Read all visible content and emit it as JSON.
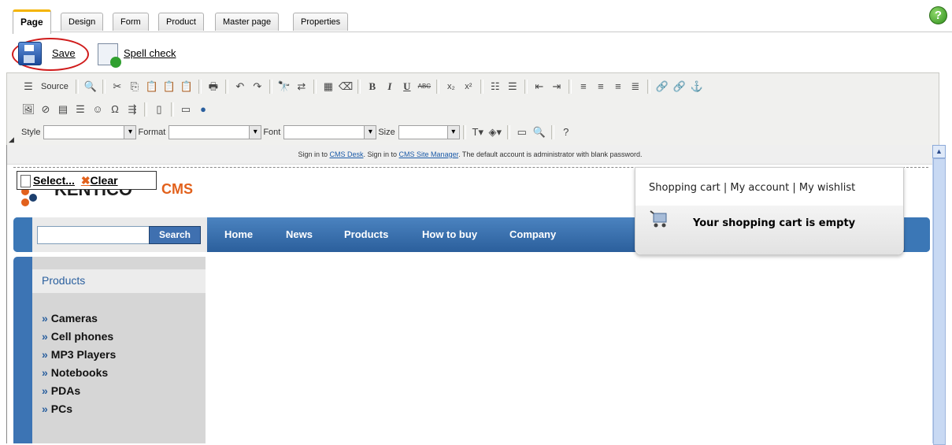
{
  "tabs": [
    "Page",
    "Design",
    "Form",
    "Product",
    "Master page",
    "Properties"
  ],
  "actions": {
    "save_label": "Save",
    "spell_label": "Spell check"
  },
  "toolbar": {
    "source_label": "Source",
    "style_label": "Style",
    "format_label": "Format",
    "font_label": "Font",
    "size_label": "Size"
  },
  "preview": {
    "signin_prefix": "Sign in to",
    "signin_desk": "CMS Desk",
    "signin_middle": ". Sign in to",
    "signin_manager": "CMS Site Manager",
    "signin_suffix": ". The default account is administrator with blank password.",
    "logo_select": "Select...",
    "logo_clear": "Clear",
    "logo_text": "KENTICO",
    "logo_cms": "CMS",
    "search_button": "Search",
    "nav": [
      "Home",
      "News",
      "Products",
      "How to buy",
      "Company"
    ],
    "cart_links": "Shopping cart | My account | My wishlist",
    "cart_empty": "Your shopping cart is empty",
    "side_title": "Products",
    "side_items": [
      "Cameras",
      "Cell phones",
      "MP3 Players",
      "Notebooks",
      "PDAs",
      "PCs"
    ]
  }
}
